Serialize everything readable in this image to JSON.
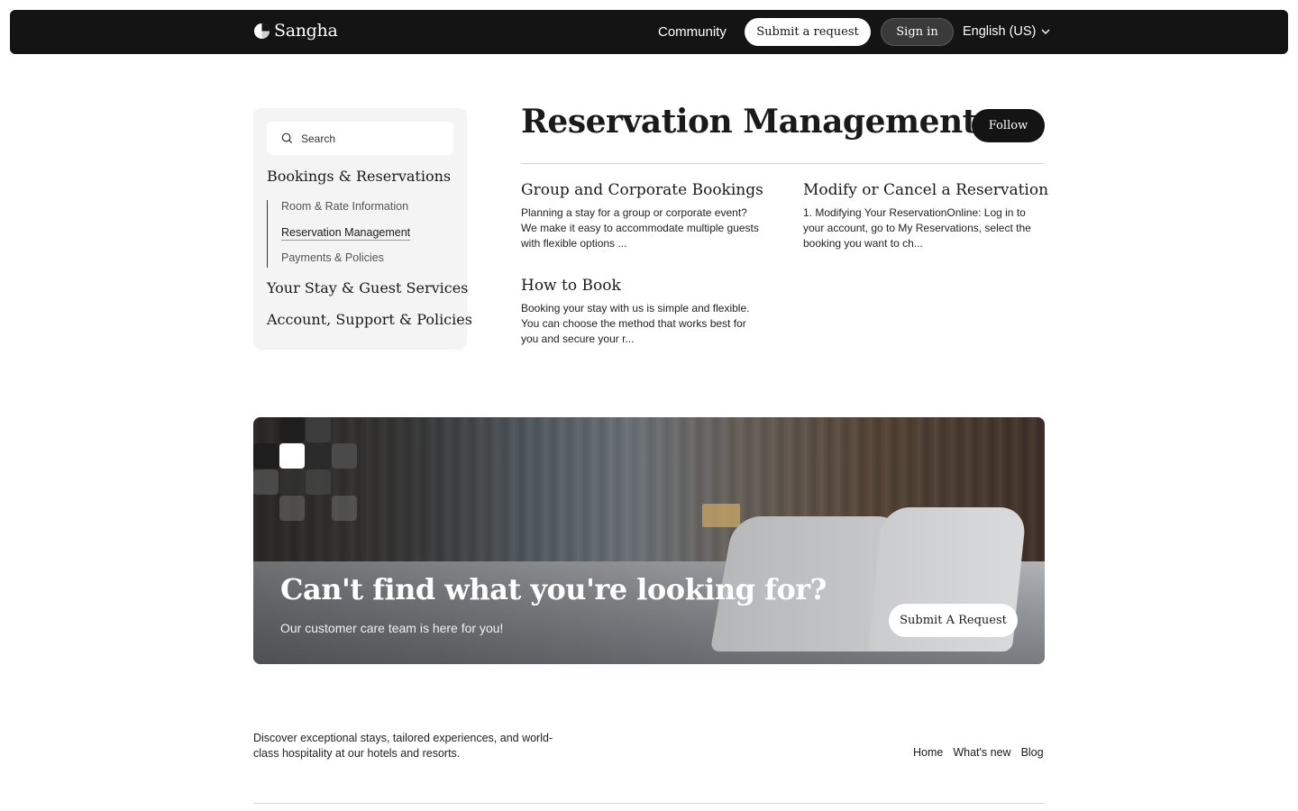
{
  "header": {
    "brand": "Sangha",
    "nav_community": "Community",
    "submit_request": "Submit a request",
    "sign_in": "Sign in",
    "language": "English (US)",
    "icons": {
      "logo": "sangha-logo-icon",
      "language_dropdown": "chevron-down-icon"
    }
  },
  "sidebar": {
    "search_placeholder": "Search",
    "categories": [
      {
        "label": "Bookings & Reservations",
        "subitems": [
          {
            "label": "Room & Rate Information",
            "active": false
          },
          {
            "label": "Reservation Management",
            "active": true
          },
          {
            "label": "Payments & Policies",
            "active": false
          }
        ]
      },
      {
        "label": "Your Stay & Guest Services"
      },
      {
        "label": "Account, Support & Policies"
      }
    ]
  },
  "main": {
    "title": "Reservation Management",
    "follow": "Follow",
    "articles": [
      {
        "title": "Group and Corporate Bookings",
        "excerpt": "Planning a stay for a group or corporate event? We make it easy to accommodate multiple guests with flexible options ..."
      },
      {
        "title": "Modify or Cancel a Reservation",
        "excerpt": "1. Modifying Your ReservationOnline: Log in to your account, go to My Reservations, select the booking you want to ch..."
      },
      {
        "title": "How to Book",
        "excerpt": "Booking your stay with us is simple and flexible. You can choose the method that works best for you and secure your r..."
      }
    ]
  },
  "banner": {
    "title": "Can't find what you're looking for?",
    "subtitle": "Our customer care team is here for you!",
    "button": "Submit A Request"
  },
  "footer": {
    "tagline": "Discover exceptional stays, tailored experiences, and world-class hospitality at our hotels and resorts.",
    "links": [
      "Home",
      "What's new",
      "Blog"
    ]
  },
  "colors": {
    "header_bg": "#141414",
    "sidebar_bg": "#f4f4f4",
    "text": "#1a1a1a",
    "divider": "#d6d6d6"
  }
}
